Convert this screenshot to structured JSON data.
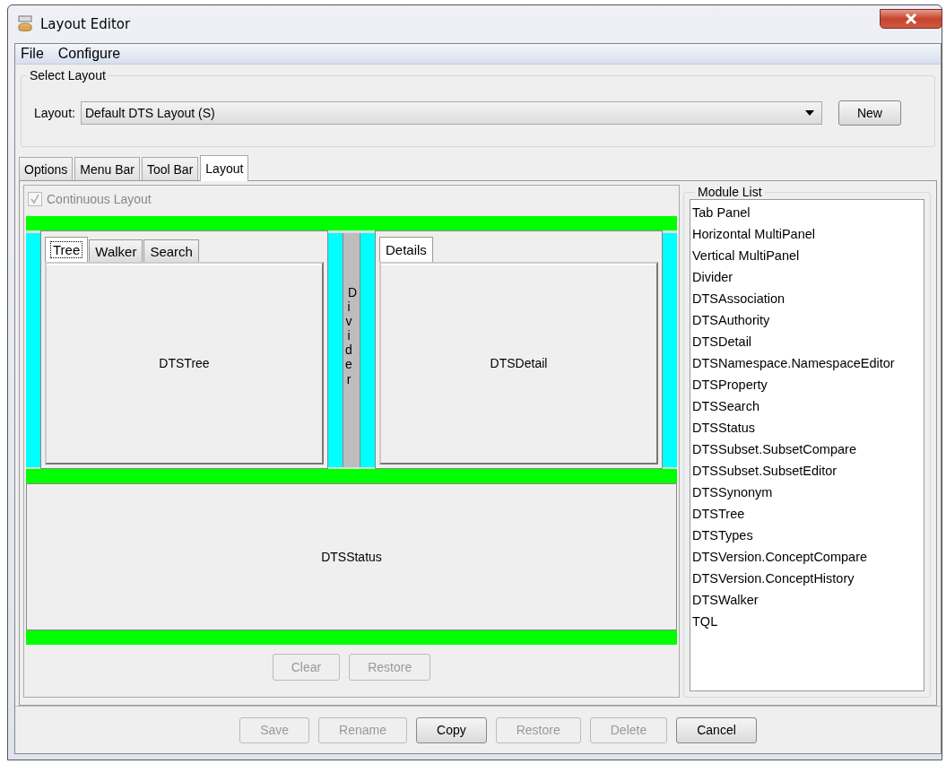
{
  "window": {
    "title": "Layout Editor"
  },
  "menu": [
    "File",
    "Configure"
  ],
  "select_layout": {
    "title": "Select Layout",
    "label": "Layout:",
    "value": "Default DTS Layout (S)",
    "button": "New"
  },
  "tabs": [
    {
      "label": "Options",
      "selected": false
    },
    {
      "label": "Menu Bar",
      "selected": false
    },
    {
      "label": "Tool Bar",
      "selected": false
    },
    {
      "label": "Layout",
      "selected": true
    }
  ],
  "layout_panel": {
    "continuous_layout": {
      "label": "Continuous Layout",
      "checked": true,
      "disabled": true
    },
    "top_row": [
      {
        "kind": "tabpanel",
        "tabs": [
          {
            "label": "Tree",
            "selected": true
          },
          {
            "label": "Walker",
            "selected": false
          },
          {
            "label": "Search",
            "selected": false
          }
        ],
        "content": "DTSTree"
      },
      {
        "kind": "divider",
        "label": "Divider"
      },
      {
        "kind": "tabpanel",
        "tabs": [
          {
            "label": "Details",
            "selected": true
          }
        ],
        "content": "DTSDetail"
      }
    ],
    "bottom": "DTSStatus",
    "buttons": [
      {
        "label": "Clear",
        "disabled": true
      },
      {
        "label": "Restore",
        "disabled": true
      }
    ]
  },
  "module_list": {
    "title": "Module List",
    "items": [
      "Tab Panel",
      "Horizontal MultiPanel",
      "Vertical MultiPanel",
      "Divider",
      "DTSAssociation",
      "DTSAuthority",
      "DTSDetail",
      "DTSNamespace.NamespaceEditor",
      "DTSProperty",
      "DTSSearch",
      "DTSStatus",
      "DTSSubset.SubsetCompare",
      "DTSSubset.SubsetEditor",
      "DTSSynonym",
      "DTSTree",
      "DTSTypes",
      "DTSVersion.ConceptCompare",
      "DTSVersion.ConceptHistory",
      "DTSWalker",
      "TQL"
    ]
  },
  "buttons": [
    {
      "label": "Save",
      "disabled": true
    },
    {
      "label": "Rename",
      "disabled": true
    },
    {
      "label": "Copy",
      "disabled": false
    },
    {
      "label": "Restore",
      "disabled": true
    },
    {
      "label": "Delete",
      "disabled": true
    },
    {
      "label": "Cancel",
      "disabled": false
    }
  ]
}
